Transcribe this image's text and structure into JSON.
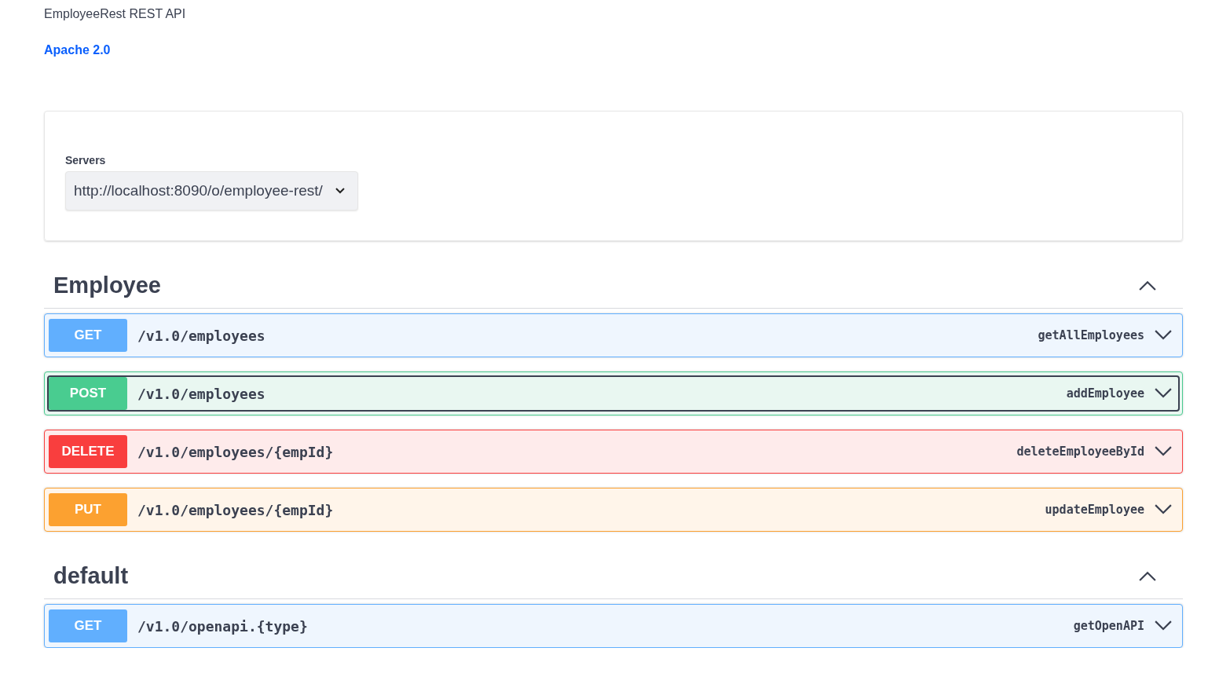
{
  "info": {
    "title": "EmployeeRest REST API",
    "license": "Apache 2.0"
  },
  "servers": {
    "label": "Servers",
    "value": "http://localhost:8090/o/employee-rest/"
  },
  "sections": [
    {
      "name": "Employee",
      "expanded": true,
      "operations": [
        {
          "kind": "get",
          "method": "GET",
          "path": "/v1.0/employees",
          "operation_id": "getAllEmployees",
          "expanded": false,
          "focused": false
        },
        {
          "kind": "post",
          "method": "POST",
          "path": "/v1.0/employees",
          "operation_id": "addEmployee",
          "expanded": false,
          "focused": true
        },
        {
          "kind": "delete",
          "method": "DELETE",
          "path": "/v1.0/employees/{empId}",
          "operation_id": "deleteEmployeeById",
          "expanded": false,
          "focused": false
        },
        {
          "kind": "put",
          "method": "PUT",
          "path": "/v1.0/employees/{empId}",
          "operation_id": "updateEmployee",
          "expanded": false,
          "focused": false
        }
      ]
    },
    {
      "name": "default",
      "expanded": true,
      "operations": [
        {
          "kind": "get",
          "method": "GET",
          "path": "/v1.0/openapi.{type}",
          "operation_id": "getOpenAPI",
          "expanded": false,
          "focused": false
        }
      ]
    }
  ]
}
